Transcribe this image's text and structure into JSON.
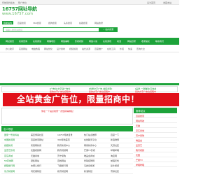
{
  "topbar": {
    "left_text": "传统简约版本",
    "left_link": "帮广告位",
    "right_links": [
      "设为首页",
      "收藏本站"
    ]
  },
  "logo": {
    "title": "16757网址导航",
    "url": "www.16757.com"
  },
  "search": {
    "tabs": [
      "导航站内",
      "百度搜索",
      "360搜索",
      "搜狗搜索",
      "头条搜索",
      "谷歌搜索",
      "网站收录"
    ],
    "active_tab": 0,
    "placeholder": "请输入搜索关键词",
    "button_label": "站内搜索"
  },
  "main_nav": [
    "网址首页",
    "实用查询",
    "在线阅读",
    "网赚项目",
    "网络兼职",
    "影视视频",
    "网络小说",
    "在线游戏",
    "动漫",
    "网站目录",
    "收录提交",
    "联系我们"
  ],
  "sub_nav": [
    "办公助手",
    "实用网站",
    "电脑教程",
    "网站优化",
    "设计素材",
    "视频剪辑",
    "站长资源",
    "百度推广",
    "在线工具",
    "外贸",
    "快递",
    "查询大全"
  ],
  "banner": {
    "text": "全站黄金广告位，限量招商中！"
  },
  "ad_rows": [
    {
      "text": "[广告位]文字链广告位"
    },
    {
      "text": "您的文字广告位招租中"
    },
    {
      "text": "[优质文字广告·诚招商家]"
    },
    {
      "text": "您的文字广告位招租中"
    },
    {
      "text": "[品牌·一键赚钱]高收益"
    },
    {
      "text": "您的文字广告位招租中"
    }
  ],
  "sidebar": {
    "title": "推荐站点",
    "items": [
      "百度搜索",
      "网站导航",
      "天猫",
      "京东商城",
      "苏宁易购",
      "唯品会",
      "爱奇艺",
      "腾讯视频",
      "优酷",
      "芒果TV",
      "哔哩哔哩"
    ]
  },
  "notice": {
    "text": "你在一个站点收录一次性获得排名！"
  },
  "main_section": {
    "title": "名人导航",
    "rows": [
      [
        "国家一号资料站",
        "美亚博客社区",
        "16757导航目录",
        "热门站点推荐",
        "百度一下"
      ],
      [
        "中国新闻网",
        "百度搜索网址",
        "360导航首页",
        "在线聊天平台",
        "新浪微博"
      ],
      [
        "搜狐新闻",
        "凤凰网新闻",
        "腾讯新闻中心",
        "网易新闻中心",
        "天涯社区"
      ],
      [
        "爱奇艺影视",
        "优酷视频网",
        "腾讯视频网",
        "芒果TV影视",
        "哔哩哔哩"
      ],
      [
        "京东商城",
        "天猫商城",
        "苏宁易购",
        "唯品会商城",
        "淘宝网"
      ],
      [
        "58同城网",
        "赶集网站",
        "百姓网站",
        "智联招聘网",
        "前程无忧"
      ],
      [
        "携程旅行网",
        "去哪儿旅行",
        "飞猪旅行网",
        "马蜂窝旅游",
        "途牛旅游"
      ],
      [
        "东方财富网",
        "同花顺财经",
        "和讯财经网",
        "新浪财经",
        "雪球社区"
      ]
    ]
  },
  "colors": {
    "brand_green": "#1da33a",
    "banner_red": "#e1101a",
    "link_red": "#e2161e"
  }
}
